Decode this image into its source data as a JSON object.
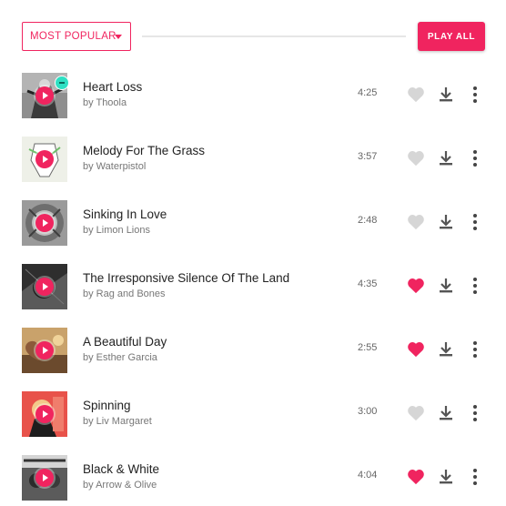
{
  "toolbar": {
    "sort_label": "MOST POPULAR",
    "play_all_label": "PLAY ALL"
  },
  "colors": {
    "accent": "#f0245f",
    "heart_off": "#d6d6d6",
    "icon_gray": "#555555",
    "badge": "#2ee0c3"
  },
  "tracks": [
    {
      "title": "Heart Loss",
      "artist": "by Thoola",
      "duration": "4:25",
      "liked": false,
      "has_badge": true
    },
    {
      "title": "Melody For The Grass",
      "artist": "by Waterpistol",
      "duration": "3:57",
      "liked": false,
      "has_badge": false
    },
    {
      "title": "Sinking In Love",
      "artist": "by Limon Lions",
      "duration": "2:48",
      "liked": false,
      "has_badge": false
    },
    {
      "title": "The Irresponsive Silence Of The Land",
      "artist": "by Rag and Bones",
      "duration": "4:35",
      "liked": true,
      "has_badge": false
    },
    {
      "title": "A Beautiful Day",
      "artist": "by Esther Garcia",
      "duration": "2:55",
      "liked": true,
      "has_badge": false
    },
    {
      "title": "Spinning",
      "artist": "by Liv Margaret",
      "duration": "3:00",
      "liked": false,
      "has_badge": false
    },
    {
      "title": "Black & White",
      "artist": "by Arrow & Olive",
      "duration": "4:04",
      "liked": true,
      "has_badge": false
    }
  ]
}
